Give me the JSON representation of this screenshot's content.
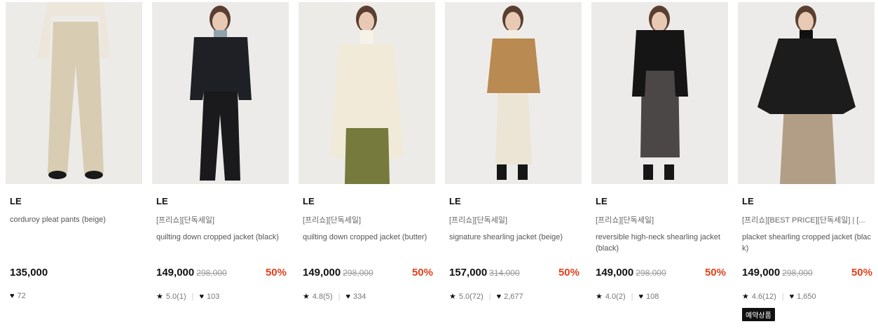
{
  "products": [
    {
      "brand": "LE",
      "tag": "",
      "name": "corduroy pleat pants (beige)",
      "price": "135,000",
      "original_price": "",
      "discount": "",
      "rating": "",
      "likes": "72",
      "badge": "",
      "colors": {
        "bg": "#ecebe8",
        "top": "#ede6da",
        "bottom": "#d8ccb2",
        "shoes": "#1a1a1a"
      }
    },
    {
      "brand": "LE",
      "tag": "[프리쇼][단독세일]",
      "name": "quilting down cropped jacket (black)",
      "price": "149,000",
      "original_price": "298,000",
      "discount": "50%",
      "rating": "5.0(1)",
      "likes": "103",
      "badge": "",
      "colors": {
        "bg": "#ecebe9",
        "top": "#1e2026",
        "bottom": "#1a1a1d",
        "inner": "#8fa3ad"
      }
    },
    {
      "brand": "LE",
      "tag": "[프리쇼][단독세일]",
      "name": "quilting down cropped jacket (butter)",
      "price": "149,000",
      "original_price": "298,000",
      "discount": "50%",
      "rating": "4.8(5)",
      "likes": "334",
      "badge": "",
      "colors": {
        "bg": "#edebe7",
        "top": "#f1ead9",
        "bottom": "#767a3c",
        "inner": "#f5f2ea"
      }
    },
    {
      "brand": "LE",
      "tag": "[프리쇼][단독세일]",
      "name": "signature shearling jacket (beige)",
      "price": "157,000",
      "original_price": "314,000",
      "discount": "50%",
      "rating": "5.0(72)",
      "likes": "2,677",
      "badge": "",
      "colors": {
        "bg": "#edecea",
        "top": "#b98a52",
        "bottom": "#ece5d6",
        "inner": "#f2ede2"
      }
    },
    {
      "brand": "LE",
      "tag": "[프리쇼][단독세일]",
      "name": "reversible high-neck shearling jacket (black)",
      "price": "149,000",
      "original_price": "298,000",
      "discount": "50%",
      "rating": "4.0(2)",
      "likes": "108",
      "badge": "",
      "colors": {
        "bg": "#ecebe9",
        "top": "#151515",
        "bottom": "#4a4746",
        "inner": "#151515"
      }
    },
    {
      "brand": "LE",
      "tag": "[프리쇼][BEST PRICE][단독세일] | [...",
      "name": "placket shearling cropped jacket (black)",
      "price": "149,000",
      "original_price": "298,000",
      "discount": "50%",
      "rating": "4.6(12)",
      "likes": "1,650",
      "badge": "예약상품",
      "colors": {
        "bg": "#ecebe9",
        "top": "#1c1c1c",
        "bottom": "#b29e86",
        "inner": "#111111"
      }
    }
  ]
}
